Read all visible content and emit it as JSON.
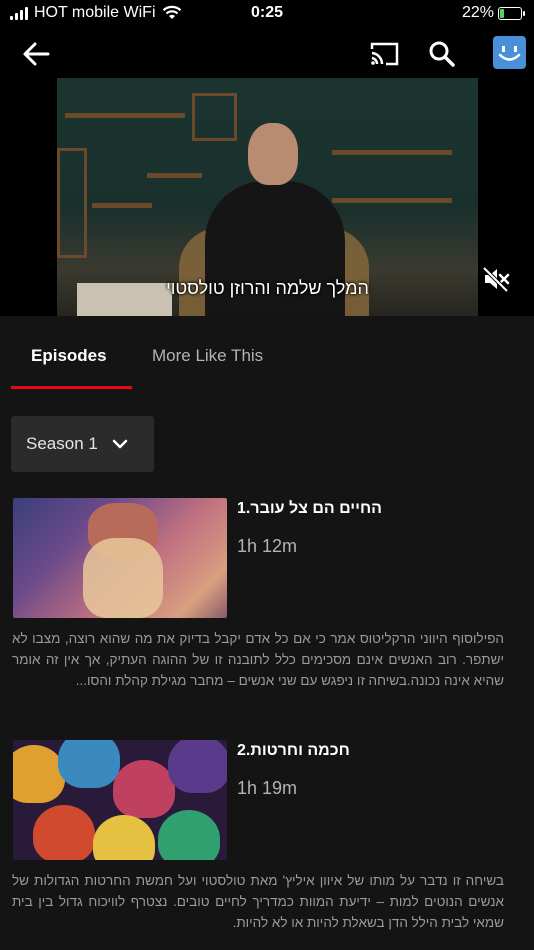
{
  "status_bar": {
    "carrier": "HOT mobile WiFi",
    "time": "0:25",
    "battery": "22%",
    "battery_level": 0.22,
    "battery_fill_color": "#4cd964"
  },
  "nav": {
    "back_icon": "arrow-left-icon",
    "cast_icon": "cast-icon",
    "search_icon": "search-icon",
    "profile_icon": "smiley-avatar-icon",
    "profile_color": "#4a90d9"
  },
  "player": {
    "subtitle": "המלך שלמה והרוזן טולסטוי",
    "mute_icon": "speaker-muted-icon"
  },
  "tabs": {
    "episodes": "Episodes",
    "more_like_this": "More Like This",
    "active_color": "#e50914"
  },
  "season": {
    "selected": "Season 1"
  },
  "episodes": [
    {
      "title": "החיים הם צל עובר.1",
      "duration": "1h 12m",
      "description": "הפילוסוף היווני הרקליטוס אמר כי אם כל אדם יקבל בדיוק את מה שהוא רוצה, מצבו לא ישתפר. רוב האנשים אינם מסכימים כלל לתובנה זו של ההוגה העתיק, אך אין זה אומר שהיא אינה נכונה.בשיחה זו ניפגש עם שני אנשים – מחבר מגילת קהלת והסו..."
    },
    {
      "title": "חכמה וחרטות.2",
      "duration": "1h 19m",
      "description": "בשיחה זו נדבר על מותו של איוון איליץ' מאת טולסטוי ועל חמשת החרטות הגדולות של אנשים הנוטים למות – ידיעת המוות כמדריך לחיים טובים. נצטרף לוויכוח גדול בין בית שמאי לבית הילל הדן בשאלת להיות או לא להיות."
    }
  ]
}
